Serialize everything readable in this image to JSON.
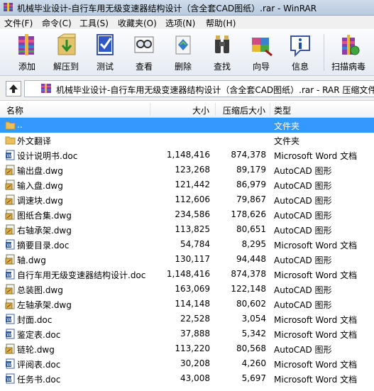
{
  "window": {
    "title": "机械毕业设计-自行车用无级变速器结构设计（含全套CAD图纸）.rar - WinRAR"
  },
  "menu": [
    {
      "label": "文件(F)"
    },
    {
      "label": "命令(C)"
    },
    {
      "label": "工具(S)"
    },
    {
      "label": "收藏夹(O)"
    },
    {
      "label": "选项(N)"
    },
    {
      "label": "帮助(H)"
    }
  ],
  "toolbar": [
    {
      "label": "添加",
      "icon": "add-archive-icon"
    },
    {
      "label": "解压到",
      "icon": "extract-to-icon"
    },
    {
      "label": "测试",
      "icon": "test-icon"
    },
    {
      "label": "查看",
      "icon": "view-icon"
    },
    {
      "label": "删除",
      "icon": "delete-icon"
    },
    {
      "label": "查找",
      "icon": "find-icon"
    },
    {
      "label": "向导",
      "icon": "wizard-icon"
    },
    {
      "label": "信息",
      "icon": "info-icon"
    },
    {
      "label": "扫描病毒",
      "icon": "virus-scan-icon"
    }
  ],
  "address": {
    "path": "机械毕业设计-自行车用无级变速器结构设计（含全套CAD图纸）.rar - RAR 压缩文件"
  },
  "columns": {
    "name": "名称",
    "size": "大小",
    "packed": "压缩后大小",
    "type": "类型"
  },
  "files": [
    {
      "name": "..",
      "size": "",
      "packed": "",
      "type": "文件夹",
      "icon": "folder",
      "selected": true
    },
    {
      "name": "外文翻译",
      "size": "",
      "packed": "",
      "type": "文件夹",
      "icon": "folder"
    },
    {
      "name": "设计说明书.doc",
      "size": "1,148,416",
      "packed": "874,378",
      "type": "Microsoft Word 文档",
      "icon": "word"
    },
    {
      "name": "输出盘.dwg",
      "size": "123,268",
      "packed": "89,179",
      "type": "AutoCAD 图形",
      "icon": "dwg"
    },
    {
      "name": "输入盘.dwg",
      "size": "121,442",
      "packed": "86,979",
      "type": "AutoCAD 图形",
      "icon": "dwg"
    },
    {
      "name": "调速块.dwg",
      "size": "112,606",
      "packed": "79,867",
      "type": "AutoCAD 图形",
      "icon": "dwg"
    },
    {
      "name": "图纸合集.dwg",
      "size": "234,586",
      "packed": "178,626",
      "type": "AutoCAD 图形",
      "icon": "dwg"
    },
    {
      "name": "右轴承架.dwg",
      "size": "113,825",
      "packed": "80,651",
      "type": "AutoCAD 图形",
      "icon": "dwg"
    },
    {
      "name": "摘要目录.doc",
      "size": "54,784",
      "packed": "8,295",
      "type": "Microsoft Word 文档",
      "icon": "word"
    },
    {
      "name": "轴.dwg",
      "size": "130,117",
      "packed": "94,448",
      "type": "AutoCAD 图形",
      "icon": "dwg"
    },
    {
      "name": "自行车用无级变速器结构设计.doc",
      "size": "1,148,416",
      "packed": "874,378",
      "type": "Microsoft Word 文档",
      "icon": "word"
    },
    {
      "name": "总装图.dwg",
      "size": "163,069",
      "packed": "122,148",
      "type": "AutoCAD 图形",
      "icon": "dwg"
    },
    {
      "name": "左轴承架.dwg",
      "size": "114,148",
      "packed": "80,602",
      "type": "AutoCAD 图形",
      "icon": "dwg"
    },
    {
      "name": "封面.doc",
      "size": "22,528",
      "packed": "3,054",
      "type": "Microsoft Word 文档",
      "icon": "word"
    },
    {
      "name": "鉴定表.doc",
      "size": "37,888",
      "packed": "5,342",
      "type": "Microsoft Word 文档",
      "icon": "word"
    },
    {
      "name": "链轮.dwg",
      "size": "113,220",
      "packed": "80,568",
      "type": "AutoCAD 图形",
      "icon": "dwg"
    },
    {
      "name": "评阅表.doc",
      "size": "30,208",
      "packed": "4,260",
      "type": "Microsoft Word 文档",
      "icon": "word"
    },
    {
      "name": "任务书.doc",
      "size": "43,008",
      "packed": "5,697",
      "type": "Microsoft Word 文档",
      "icon": "word"
    }
  ]
}
